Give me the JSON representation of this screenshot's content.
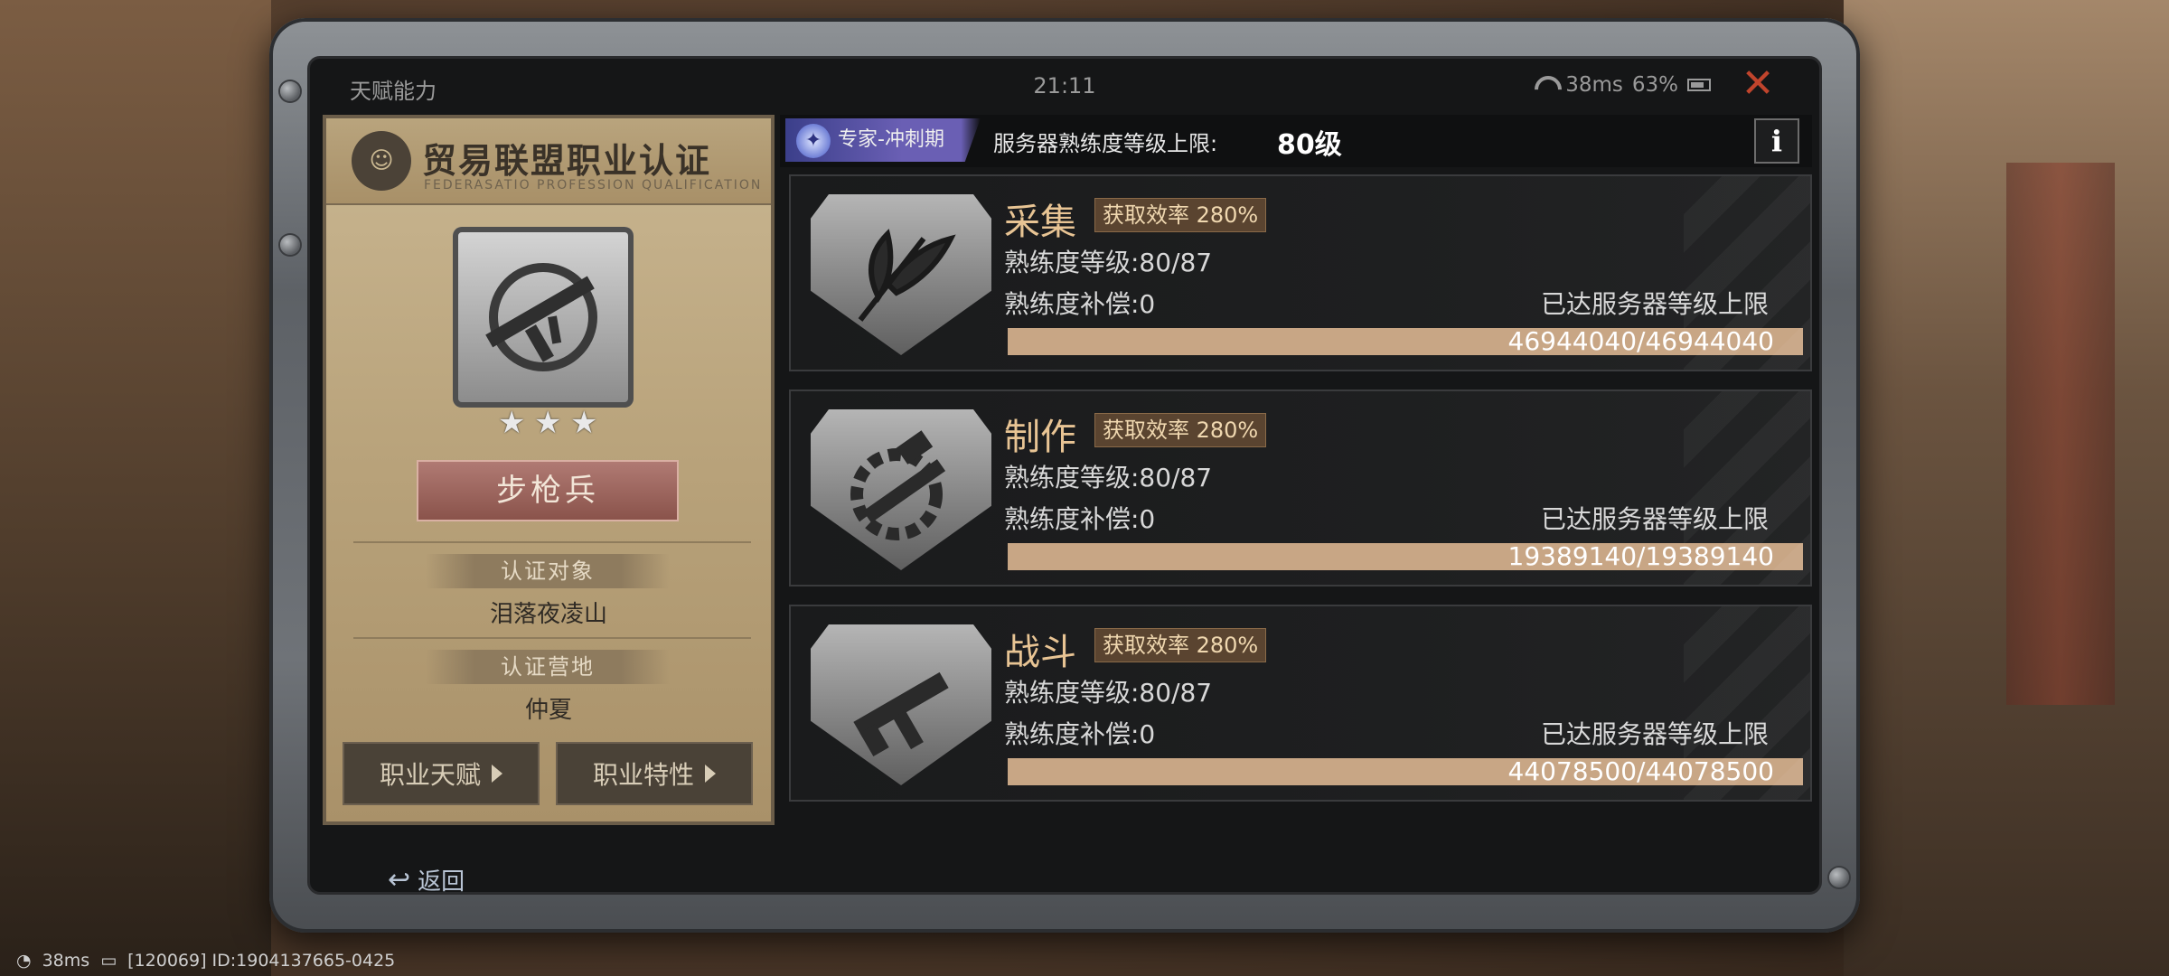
{
  "status": {
    "title": "天赋能力",
    "clock": "21:11",
    "ping": "38ms",
    "battery": "63%"
  },
  "cert": {
    "title": "贸易联盟职业认证",
    "subtitle": "FEDERASATIO PROFESSION QUALIFICATION",
    "class_name": "步枪兵",
    "stars": 3,
    "target_label": "认证对象",
    "target_value": "泪落夜凌山",
    "camp_label": "认证营地",
    "camp_value": "仲夏",
    "btn_talent": "职业天赋",
    "btn_trait": "职业特性"
  },
  "header": {
    "tier": "专家-冲刺期",
    "limit_label": "服务器熟练度等级上限:",
    "limit_value": "80级",
    "info": "i"
  },
  "skills": [
    {
      "name": "采集",
      "efficiency": "获取效率 280%",
      "level": "熟练度等级:80/87",
      "compensation": "熟练度补偿:0",
      "cap": "已达服务器等级上限",
      "progress": "46944040/46944040",
      "progress_fraction": 1.0
    },
    {
      "name": "制作",
      "efficiency": "获取效率 280%",
      "level": "熟练度等级:80/87",
      "compensation": "熟练度补偿:0",
      "cap": "已达服务器等级上限",
      "progress": "19389140/19389140",
      "progress_fraction": 1.0
    },
    {
      "name": "战斗",
      "efficiency": "获取效率 280%",
      "level": "熟练度等级:80/87",
      "compensation": "熟练度补偿:0",
      "cap": "已达服务器等级上限",
      "progress": "44078500/44078500",
      "progress_fraction": 1.0
    }
  ],
  "back_label": "返回",
  "footer": {
    "ping": "38ms",
    "info": "[120069] ID:1904137665-0425"
  },
  "colors": {
    "accent": "#c8a685",
    "skill_name": "#e8c494",
    "close": "#c0442c"
  }
}
